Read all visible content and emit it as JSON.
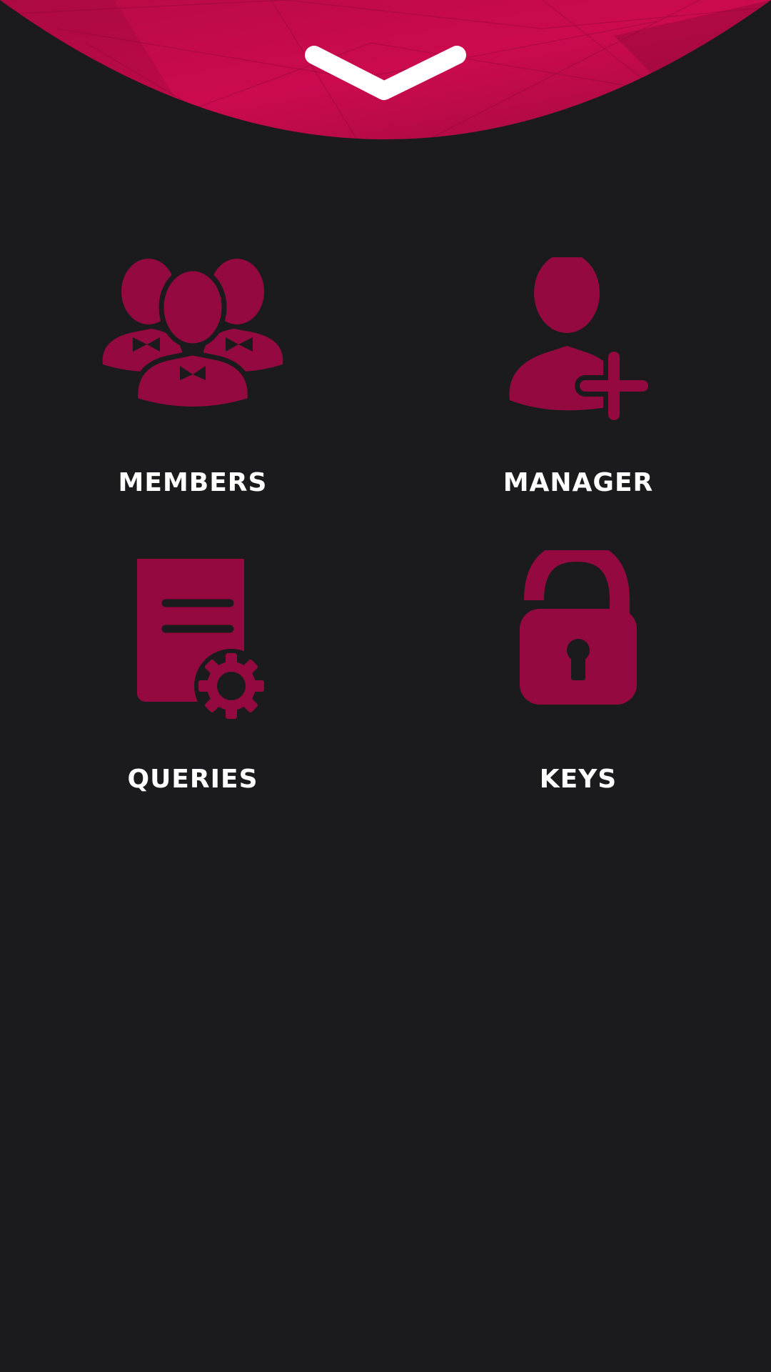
{
  "theme": {
    "background": "#1b1b1d",
    "accent": "#c90a4e",
    "icon_color": "#940a40",
    "label_color": "#ffffff"
  },
  "header": {
    "collapse_icon": "chevron-down-icon"
  },
  "tiles": [
    {
      "label": "MEMBERS",
      "icon": "users-group-icon"
    },
    {
      "label": "MANAGER",
      "icon": "add-user-icon"
    },
    {
      "label": "QUERIES",
      "icon": "document-gear-icon"
    },
    {
      "label": "KEYS",
      "icon": "unlocked-padlock-icon"
    }
  ]
}
